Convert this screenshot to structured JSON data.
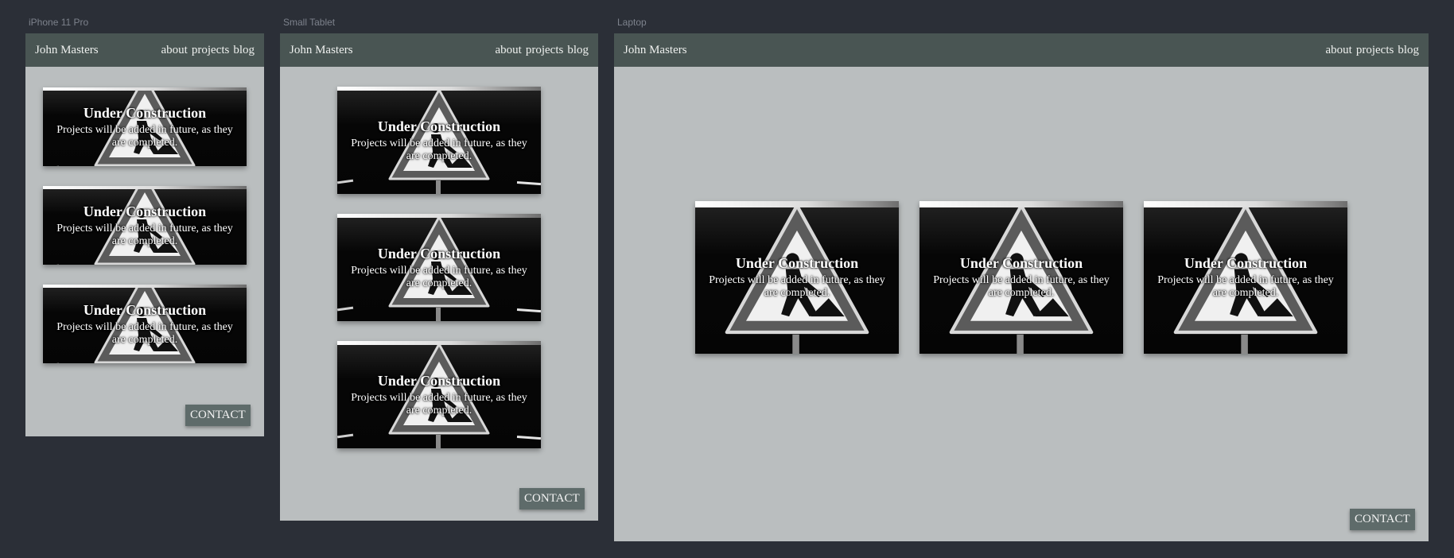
{
  "labels": {
    "iphone": "iPhone 11 Pro",
    "tablet": "Small Tablet",
    "laptop": "Laptop"
  },
  "nav": {
    "name": "John Masters",
    "about": "about",
    "projects": "projects",
    "blog": "blog"
  },
  "card": {
    "title": "Under Construction",
    "text": "Projects will be added in future, as they are completed.",
    "image_icon": "construction-sign-icon"
  },
  "contact": "CONTACT",
  "colors": {
    "page": "#2b2f37",
    "frame": "#babebf",
    "nav": "#495553",
    "contact": "#5e6b6a"
  }
}
